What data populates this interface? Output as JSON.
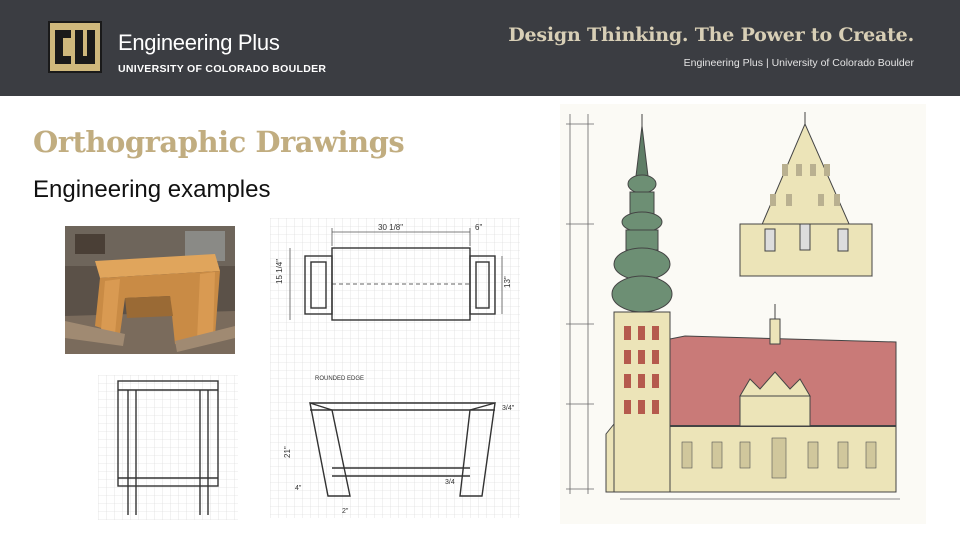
{
  "header": {
    "brand_name": "Engineering Plus",
    "brand_sub": "UNIVERSITY OF COLORADO BOULDER",
    "tagline": "Design Thinking. The Power to Create.",
    "tagline_sub": "Engineering Plus | University of Colorado Boulder"
  },
  "slide": {
    "title": "Orthographic Drawings",
    "subtitle": "Engineering examples"
  },
  "figures": {
    "drawing_labels": {
      "top_width": "30 1/8\"",
      "top_left": "6\"",
      "side_left": "15 1/4\"",
      "side_right": "13\"",
      "front_note": "ROUNDED EDGE",
      "front_depth": "21\"",
      "front_right": "3/4\"",
      "front_small": "3/4",
      "front_bottom": "2\"",
      "front_left_low": "4\""
    }
  },
  "colors": {
    "header_bg": "#3b3d42",
    "title_gold": "#c1ad80",
    "logo_gold": "#cfb87c",
    "roof_red": "#b8585a",
    "dome_green": "#6d8f74"
  }
}
